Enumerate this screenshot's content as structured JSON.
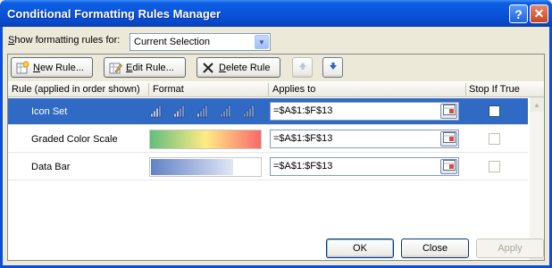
{
  "window": {
    "title": "Conditional Formatting Rules Manager",
    "help_glyph": "?",
    "close_glyph": "✕"
  },
  "show_rules": {
    "label_prefix": "S",
    "label_rest": "how formatting rules for:",
    "value": "Current Selection"
  },
  "toolbar": {
    "new_rule": {
      "u": "N",
      "rest": "ew Rule..."
    },
    "edit_rule": {
      "u": "E",
      "rest": "dit Rule..."
    },
    "delete_rule": {
      "u": "D",
      "rest": "elete Rule"
    }
  },
  "columns": {
    "rule": "Rule (applied in order shown)",
    "format": "Format",
    "applies_to": "Applies to",
    "stop_if_true": "Stop If True"
  },
  "rules": [
    {
      "name": "Icon Set",
      "format_type": "icon-set",
      "applies_to": "=$A$1:$F$13",
      "stop_if_true": false,
      "selected": true
    },
    {
      "name": "Graded Color Scale",
      "format_type": "color-scale",
      "applies_to": "=$A$1:$F$13",
      "stop_if_true": false,
      "selected": false
    },
    {
      "name": "Data Bar",
      "format_type": "data-bar",
      "applies_to": "=$A$1:$F$13",
      "stop_if_true": false,
      "selected": false
    }
  ],
  "buttons": {
    "ok": "OK",
    "close": "Close",
    "apply": "Apply"
  },
  "colors": {
    "selection": "#316ac5",
    "title_bar": "#0a55da"
  }
}
